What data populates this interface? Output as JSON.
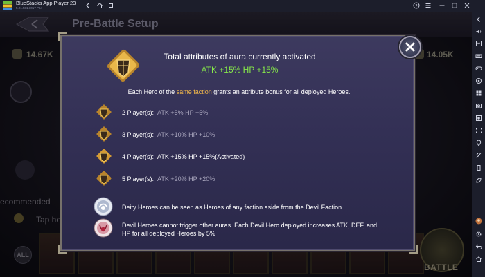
{
  "window": {
    "title": "BlueStacks App Player 23",
    "version": "5.21.581.1017 P64",
    "colors": {
      "titlebar": "#1c1e2b",
      "accent": "#86e84a",
      "highlight": "#f0b74b"
    }
  },
  "titlebar_icons": [
    "back-icon",
    "home-icon",
    "tabs-icon",
    "help-icon",
    "menu-icon",
    "minimize-icon",
    "maximize-icon",
    "close-icon"
  ],
  "sidebar_icons": [
    "expand-icon",
    "volume-icon",
    "keymap-icon",
    "keyboard-icon",
    "gamepad-icon",
    "macro-icon",
    "multi-instance-icon",
    "screenshot-icon",
    "record-icon",
    "fullscreen-icon",
    "location-icon",
    "shake-icon",
    "rotate-icon",
    "eco-mode-icon",
    "avatar-icon",
    "settings-icon",
    "back-nav-icon",
    "home-nav-icon"
  ],
  "game": {
    "screen_title": "Pre-Battle Setup",
    "power_left": "14.67K",
    "power_right": "14.05K",
    "recommended": "ecommended",
    "tap_hint": "Tap he",
    "all_label": "ALL",
    "battle_label": "BATTLE"
  },
  "dialog": {
    "title": "Total attributes of aura currently activated",
    "bonus": "ATK +15%  HP +15%",
    "intro_before": "Each Hero of the ",
    "intro_highlight": "same faction",
    "intro_after": " grants an attribute bonus for all deployed Heroes.",
    "tiers": [
      {
        "label": "2 Player(s):",
        "value": "ATK +5%  HP +5%",
        "active": false
      },
      {
        "label": "3 Player(s):",
        "value": "ATK +10%  HP +10%",
        "active": false
      },
      {
        "label": "4 Player(s):",
        "value": "ATK +15%  HP +15%(Activated)",
        "active": true
      },
      {
        "label": "5 Player(s):",
        "value": "ATK +20%  HP +20%",
        "active": false
      }
    ],
    "notes": [
      {
        "icon": "deity-faction-icon",
        "text": "Deity Heroes can be seen as Heroes of any faction aside from the Devil Faction."
      },
      {
        "icon": "devil-faction-icon",
        "text": "Devil Heroes cannot trigger other auras. Each Devil Hero deployed increases ATK, DEF, and HP for all deployed Heroes by 5%"
      }
    ]
  }
}
